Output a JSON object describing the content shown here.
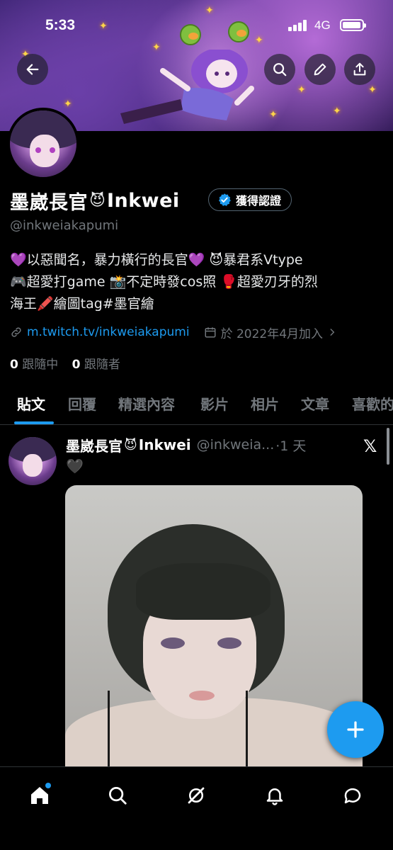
{
  "status_bar": {
    "time": "5:33",
    "network": "4G"
  },
  "profile": {
    "display_name": "墨崴長官",
    "name_suffix": "Inkwei",
    "verified_label": "獲得認證",
    "handle": "@inkweiakapumi",
    "bio_lines": [
      "💜以惡聞名，暴力橫行的長官💜 😈暴君系Vtype",
      "🎮超愛打game 📸不定時發cos照 🥊超愛刃牙的烈",
      "海王🖍️繪圖tag#墨官繪"
    ],
    "link": "m.twitch.tv/inkweiakapumi",
    "joined": "於 2022年4月加入",
    "following_count": "0",
    "following_label": "跟隨中",
    "followers_count": "0",
    "followers_label": "跟隨者"
  },
  "tabs": [
    {
      "label": "貼文"
    },
    {
      "label": "回覆"
    },
    {
      "label": "精選內容"
    },
    {
      "label": "影片"
    },
    {
      "label": "相片"
    },
    {
      "label": "文章"
    },
    {
      "label": "喜歡的"
    }
  ],
  "post": {
    "author_name": "墨崴長官",
    "author_suffix": "Inkwei",
    "author_handle": "@inkweia...",
    "time": "·1 天",
    "text": "🖤",
    "x_mark": "𝕏"
  },
  "colors": {
    "accent": "#1d9bf0",
    "background": "#000000",
    "muted": "#71767b"
  },
  "icons": {
    "back": "back-arrow-icon",
    "search": "search-icon",
    "edit": "pencil-icon",
    "share": "share-icon",
    "fab": "plus-icon",
    "nav": [
      "home-icon",
      "search-icon",
      "grok-icon",
      "bell-icon",
      "message-icon"
    ]
  }
}
